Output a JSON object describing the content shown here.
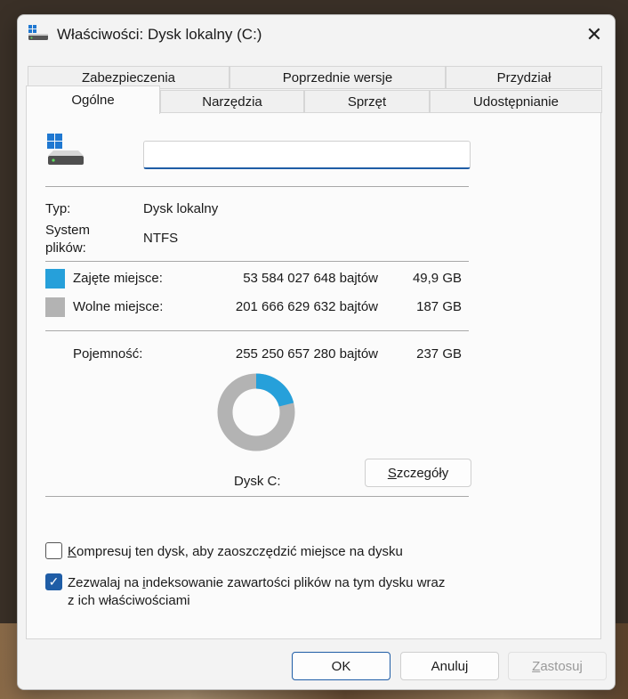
{
  "window": {
    "title": "Właściwości: Dysk lokalny (C:)",
    "close_glyph": "✕"
  },
  "tabs_top": [
    "Zabezpieczenia",
    "Poprzednie wersje",
    "Przydział"
  ],
  "tabs_bottom": [
    "Ogólne",
    "Narzędzia",
    "Sprzęt",
    "Udostępnianie"
  ],
  "active_tab": "Ogólne",
  "general": {
    "drive_name_value": "",
    "type_label": "Typ:",
    "type_value": "Dysk lokalny",
    "fs_label_line1": "System",
    "fs_label_line2": "plików:",
    "fs_value": "NTFS",
    "used_label": "Zajęte miejsce:",
    "used_bytes": "53 584 027 648 bajtów",
    "used_size": "49,9 GB",
    "free_label": "Wolne miejsce:",
    "free_bytes": "201 666 629 632 bajtów",
    "free_size": "187 GB",
    "capacity_label": "Pojemność:",
    "capacity_bytes": "255 250 657 280 bajtów",
    "capacity_size": "237 GB",
    "drive_label": "Dysk C:",
    "details_button_pre": "",
    "details_button_underline": "S",
    "details_button_rest": "zczegóły",
    "used_fraction": 0.21,
    "compress_pre": "",
    "compress_underline": "K",
    "compress_rest": "ompresuj ten dysk, aby zaoszczędzić miejsce na dysku",
    "compress_checked": false,
    "index_pre": "Zezwalaj na ",
    "index_underline": "i",
    "index_rest": "ndeksowanie zawartości plików na tym dysku wraz",
    "index_line2": "z ich właściwościami",
    "index_checked": true,
    "checkmark": "✓"
  },
  "buttons": {
    "ok": "OK",
    "cancel": "Anuluj",
    "apply_underline": "Z",
    "apply_rest": "astosuj"
  },
  "colors": {
    "used": "#26a0da",
    "free": "#b3b3b3",
    "accent": "#1f5da6"
  },
  "icons": {
    "title": "drive-icon",
    "drive": "windows-drive-icon",
    "close": "close-icon"
  }
}
